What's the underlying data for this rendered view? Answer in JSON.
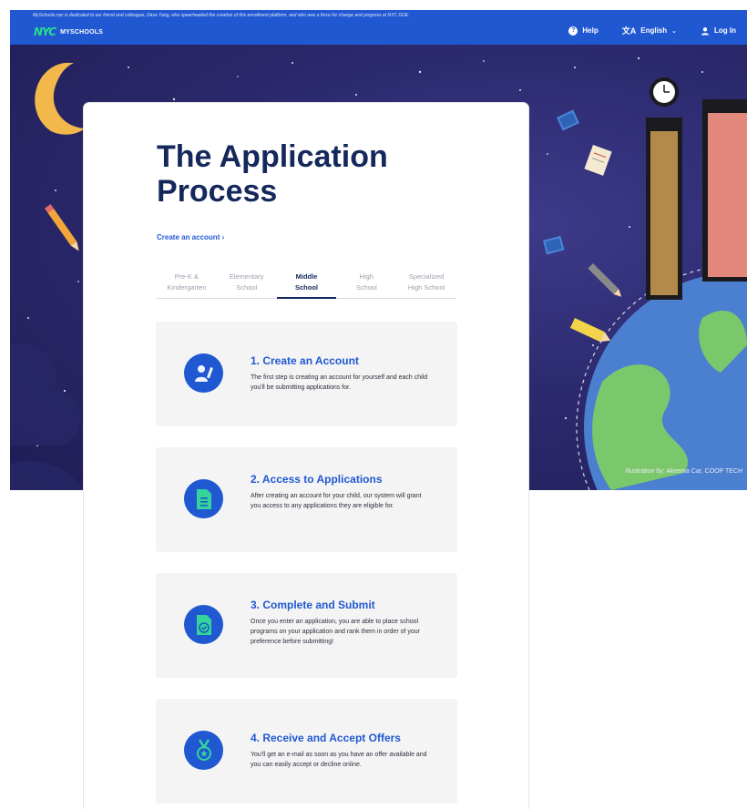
{
  "header": {
    "dedication": "MySchools.nyc is dedicated to our friend and colleague, Dave Yang, who spearheaded the creation of this enrollment platform, and who was a force for change and progress at NYC DOE.",
    "logo": "NYC",
    "brand": "MYSCHOOLS",
    "help_label": "Help",
    "language_label": "English",
    "login_label": "Log In"
  },
  "hero": {
    "credit": "Illustration by: Akeema Car, COOP TECH"
  },
  "main": {
    "title": "The Application Process",
    "create_account_link": "Create an account ›",
    "tabs": [
      {
        "line1": "Pre-K &",
        "line2": "Kindergarten"
      },
      {
        "line1": "Elementary",
        "line2": "School"
      },
      {
        "line1": "Middle",
        "line2": "School"
      },
      {
        "line1": "High",
        "line2": "School"
      },
      {
        "line1": "Specialized",
        "line2": "High School"
      }
    ],
    "active_tab": "Middle School",
    "steps": [
      {
        "title": "1. Create an Account",
        "description": "The first step is creating an account for yourself and each child you'll be submitting applications for.",
        "icon": "person-edit-icon"
      },
      {
        "title": "2. Access to Applications",
        "description": "After creating an account for your child, our system will grant you access to any applications they are eligible for.",
        "icon": "document-icon"
      },
      {
        "title": "3. Complete and Submit",
        "description": "Once you enter an application, you are able to place school programs on your application and rank them in order of your preference before submitting!",
        "icon": "document-check-icon"
      },
      {
        "title": "4. Receive and Accept Offers",
        "description": "You'll get an e-mail as soon as you have an offer available and you can easily accept or decline online.",
        "icon": "medal-icon"
      }
    ]
  },
  "colors": {
    "primary": "#2058d1",
    "title": "#15285c",
    "hero_bg": "#2c2a6e",
    "step_bg": "#f4f4f5"
  }
}
